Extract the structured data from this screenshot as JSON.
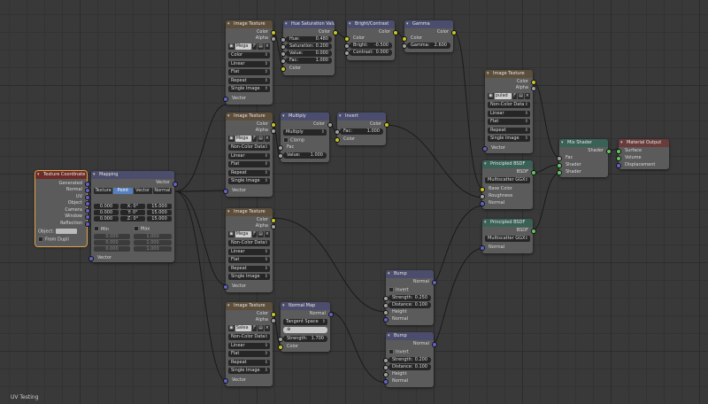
{
  "status": {
    "label": "UV Testing"
  },
  "tc": {
    "title": "Texture Coordinate",
    "outs": [
      "Generated",
      "Normal",
      "UV",
      "Object",
      "Camera",
      "Window",
      "Reflection"
    ],
    "object_label": "Object:",
    "from_dupli": "From Dupli"
  },
  "map": {
    "title": "Mapping",
    "vector_out": "Vector",
    "tabs": [
      "Texture",
      "Point",
      "Vector",
      "Normal"
    ],
    "loc": [
      "0.000",
      "0.000",
      "0.000"
    ],
    "rot_axes": [
      "X:",
      "Y:",
      "Z:"
    ],
    "rot": [
      "0°",
      "0°",
      "0°"
    ],
    "scale": [
      "15.000",
      "15.000",
      "15.000"
    ],
    "min_label": "Min",
    "max_label": "Max",
    "min": [
      "0.000",
      "0.000",
      "0.000"
    ],
    "max": [
      "1.000",
      "1.000",
      "1.000"
    ],
    "vector_in": "Vector"
  },
  "it1": {
    "title": "Image Texture",
    "color": "Color",
    "alpha": "Alpha",
    "image": "Mega",
    "proj": "Color",
    "interp": "Linear",
    "flat": "Flat",
    "ext": "Repeat",
    "src": "Single Image",
    "vec": "Vector"
  },
  "hsv": {
    "title": "Hue Saturation Value",
    "color_out": "Color",
    "hue_l": "Hue:",
    "hue": "0.480",
    "sat_l": "Saturation:",
    "sat": "0.200",
    "val_l": "Value:",
    "val": "0.000",
    "fac_l": "Fac:",
    "fac": "1.000",
    "color_in": "Color"
  },
  "bc": {
    "title": "Bright/Contrast",
    "color_out": "Color",
    "color_in": "Color",
    "bright_l": "Bright:",
    "bright": "-0.500",
    "contrast_l": "Contrast:",
    "contrast": "0.000"
  },
  "gamma": {
    "title": "Gamma",
    "color_out": "Color",
    "color_in": "Color",
    "g_l": "Gamma:",
    "g": "2.600"
  },
  "it2": {
    "title": "Image Texture",
    "color": "Color",
    "alpha": "Alpha",
    "image": "Mega",
    "proj": "Non-Color Data",
    "interp": "Linear",
    "flat": "Flat",
    "ext": "Repeat",
    "src": "Single Image",
    "vec": "Vector"
  },
  "mul": {
    "title": "Multiply",
    "color_out": "Color",
    "mode": "Multiply",
    "clamp": "Clamp",
    "fac_l": "Fac",
    "value_l": "Value:",
    "value": "1.000"
  },
  "inv": {
    "title": "Invert",
    "color_out": "Color",
    "fac_l": "Fac:",
    "fac": "1.000",
    "color_in": "Color"
  },
  "it3": {
    "title": "Image Texture",
    "color": "Color",
    "alpha": "Alpha",
    "image": "Mega",
    "proj": "Non-Color Data",
    "interp": "Linear",
    "flat": "Flat",
    "ext": "Repeat",
    "src": "Single Image",
    "vec": "Vector"
  },
  "it4": {
    "title": "Image Texture",
    "color": "Color",
    "alpha": "Alpha",
    "image": "Salea",
    "proj": "Non-Color Data",
    "interp": "Linear",
    "flat": "Flat",
    "ext": "Repeat",
    "src": "Single Image",
    "vec": "Vector"
  },
  "nmap": {
    "title": "Normal Map",
    "normal_out": "Normal",
    "space": "Tangent Space",
    "str_l": "Strength:",
    "str": "1.700",
    "color_in": "Color"
  },
  "bump1": {
    "title": "Bump",
    "normal_out": "Normal",
    "invert": "Invert",
    "str_l": "Strength:",
    "str": "0.250",
    "dist_l": "Distance:",
    "dist": "0.100",
    "height": "Height",
    "normal_in": "Normal"
  },
  "bump2": {
    "title": "Bump",
    "normal_out": "Normal",
    "invert": "Invert",
    "str_l": "Strength:",
    "str": "0.200",
    "dist_l": "Distance:",
    "dist": "0.100",
    "height": "Height",
    "normal_in": "Normal"
  },
  "it5": {
    "title": "Image Texture",
    "color": "Color",
    "alpha": "Alpha",
    "image": "pulad",
    "proj": "Non-Color Data",
    "interp": "Linear",
    "flat": "Flat",
    "ext": "Repeat",
    "src": "Single Image",
    "vec": "Vector"
  },
  "p1": {
    "title": "Principled BSDF",
    "bsdf": "BSDF",
    "dist": "Multiscatter GGX",
    "base": "Base Color",
    "rough": "Roughness",
    "normal": "Normal"
  },
  "p2": {
    "title": "Principled BSDF",
    "bsdf": "BSDF",
    "dist": "Multiscatter GGX",
    "normal": "Normal"
  },
  "mix": {
    "title": "Mix Shader",
    "shader_out": "Shader",
    "fac": "Fac",
    "s1": "Shader",
    "s2": "Shader"
  },
  "mo": {
    "title": "Material Output",
    "surface": "Surface",
    "volume": "Volume",
    "disp": "Displacement"
  },
  "colors": {
    "wire": "#1a1a1a",
    "accent": "#e1a34b",
    "sock_color": "#c7c729",
    "sock_float": "#a1a1a1",
    "sock_vector": "#6363c7",
    "sock_shader": "#63c763"
  }
}
